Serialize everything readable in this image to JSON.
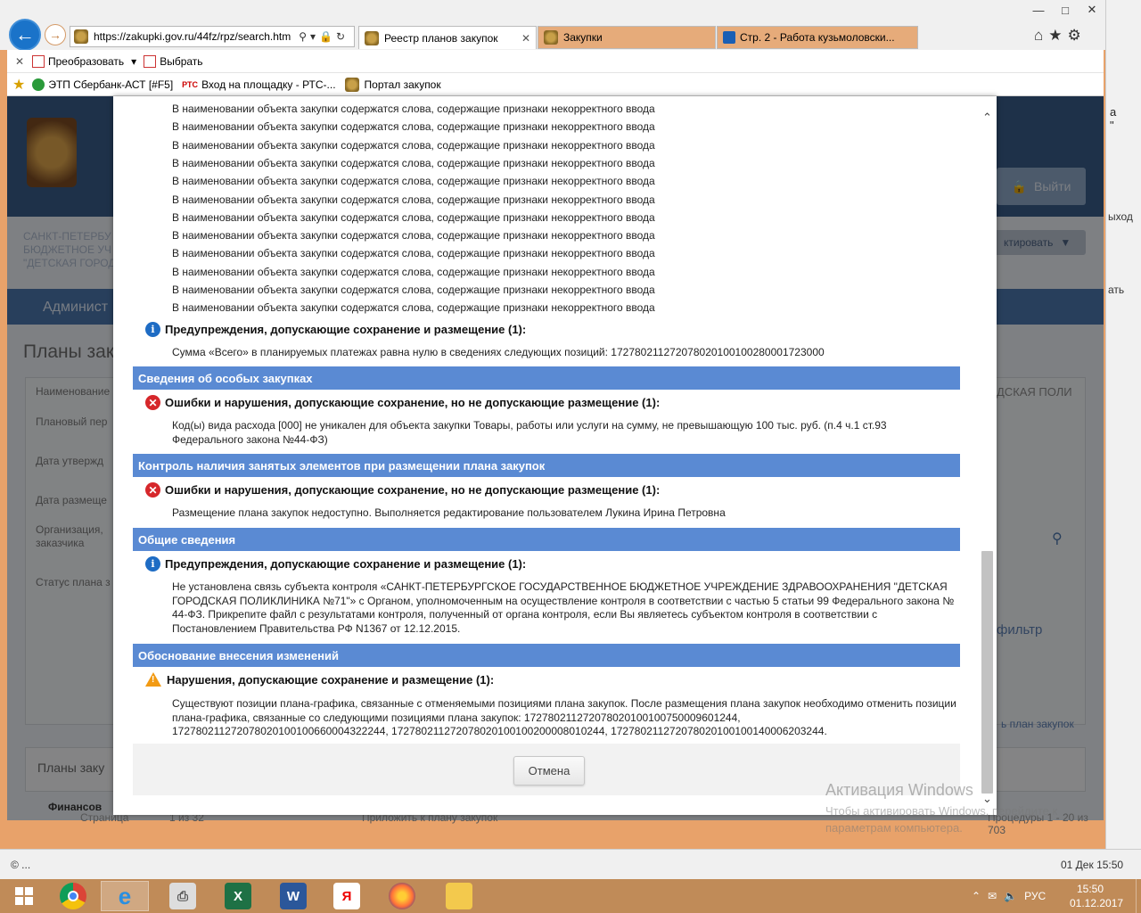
{
  "browser": {
    "url": "https://zakupki.gov.ru/44fz/rpz/search.htm",
    "tabs": [
      {
        "label": "Реестр планов закупок"
      },
      {
        "label": "Закупки"
      },
      {
        "label": "Стр. 2 - Работа кузьмоловски..."
      }
    ],
    "command_bar": {
      "convert": "Преобразовать",
      "select": "Выбрать"
    },
    "favorites": [
      {
        "label": "ЭТП Сбербанк-АСТ [#F5]"
      },
      {
        "label": "Вход на площадку - РТС-..."
      },
      {
        "label": "Портал закупок"
      }
    ],
    "status_left": "© ...",
    "status_right": "01 Дек 15:50"
  },
  "background_page": {
    "logout": "Выйти",
    "edit": "ктировать",
    "org_lines": [
      "САНКТ-ПЕТЕРБУ",
      "БЮДЖЕТНОЕ УЧ",
      "\"ДЕТСКАЯ ГОРОД"
    ],
    "admin_menu": "Админист",
    "title": "Планы зак",
    "labels": [
      "Наименование",
      "Плановый пер",
      "Дата утвержд",
      "Дата размеще",
      "Организация,",
      "заказчика",
      "Статус плана з"
    ],
    "polic": "ДСКАЯ ПОЛИ",
    "filter": "фильтр",
    "add_plan": "ь план закупок",
    "plans_section": "Планы заку",
    "fin": "Финансов",
    "pager_left": "Страница",
    "pager_of": "1 из 32",
    "pager_mid": "Приложить к плану закупок",
    "pager_right": "Процедуры 1 - 20 из 703"
  },
  "side_window": {
    "a": "а",
    "a2": "\"",
    "b": "ыход",
    "c": "ать"
  },
  "modal": {
    "repeated_error_line": "В наименовании объекта закупки содержатся слова, содержащие признаки некорректного ввода",
    "repeated_count": 12,
    "blocks": [
      {
        "type": "info",
        "title": "Предупреждения, допускающие сохранение и размещение (1):",
        "message": "Сумма «Всего» в планируемых платежах равна нулю в сведениях следующих позиций: 172780211272078020100100280001723000"
      },
      {
        "type": "section",
        "title": "Сведения об особых закупках"
      },
      {
        "type": "error",
        "title": "Ошибки и нарушения, допускающие сохранение, но не допускающие размещение (1):",
        "message": "Код(ы) вида расхода [000] не уникален для объекта закупки Товары, работы или услуги на сумму, не превышающую 100 тыс. руб. (п.4 ч.1 ст.93 Федерального закона №44-ФЗ)"
      },
      {
        "type": "section",
        "title": "Контроль наличия занятых элементов при размещении плана закупок"
      },
      {
        "type": "error",
        "title": "Ошибки и нарушения, допускающие сохранение, но не допускающие размещение (1):",
        "message": "Размещение плана закупок недоступно. Выполняется редактирование пользователем Лукина Ирина Петровна"
      },
      {
        "type": "section",
        "title": "Общие сведения"
      },
      {
        "type": "info",
        "title": "Предупреждения, допускающие сохранение и размещение (1):",
        "message": "Не установлена связь субъекта контроля «САНКТ-ПЕТЕРБУРГСКОЕ ГОСУДАРСТВЕННОЕ БЮДЖЕТНОЕ УЧРЕЖДЕНИЕ ЗДРАВООХРАНЕНИЯ \"ДЕТСКАЯ ГОРОДСКАЯ ПОЛИКЛИНИКА №71\"» с Органом, уполномоченным на осуществление контроля в соответствии с частью 5 статьи 99 Федерального закона № 44-ФЗ. Прикрепите файл с результатами контроля, полученный от органа контроля, если Вы являетесь субъектом контроля в соответствии с Постановлением Правительства РФ N1367 от 12.12.2015."
      },
      {
        "type": "section",
        "title": "Обоснование внесения изменений"
      },
      {
        "type": "warning",
        "title": "Нарушения, допускающие сохранение и размещение (1):",
        "message": "Существуют позиции плана-графика, связанные с отменяемыми позициями плана закупок. После размещения плана закупок необходимо отменить позиции плана-графика, связанные со следующими позициями плана закупок: 172780211272078020100100750009601244, 172780211272078020100100660004322244, 172780211272078020100100200008010244, 172780211272078020100100140006203244."
      }
    ],
    "cancel_button": "Отмена"
  },
  "watermark": {
    "title": "Активация Windows",
    "line1": "Чтобы активировать Windows, перейдите к",
    "line2": "параметрам компьютера."
  },
  "taskbar": {
    "apps": [
      "start-icon",
      "chrome-icon",
      "ie-icon",
      "printer-icon",
      "excel-icon",
      "word-icon",
      "yandex-icon",
      "firefox-icon",
      "explorer-icon"
    ],
    "lang": "РУС",
    "time": "15:50",
    "date": "01.12.2017"
  }
}
